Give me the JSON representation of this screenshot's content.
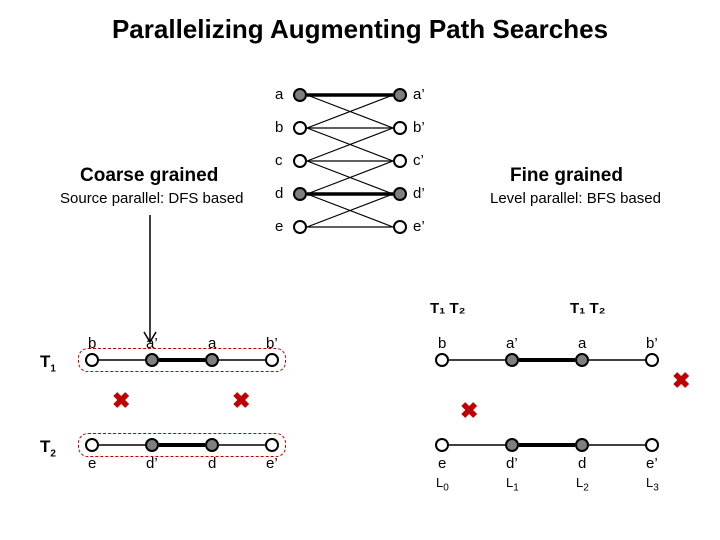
{
  "title": "Parallelizing Augmenting Path Searches",
  "left": {
    "heading": "Coarse grained",
    "sub": "Source parallel: DFS based"
  },
  "right": {
    "heading": "Fine grained",
    "sub": "Level parallel: BFS based"
  },
  "bipartite": {
    "left": [
      "a",
      "b",
      "c",
      "d",
      "e"
    ],
    "right": [
      "a’",
      "b’",
      "c’",
      "d’",
      "e’"
    ]
  },
  "threads": {
    "t1": "T",
    "t1s": "1",
    "t2": "T",
    "t2s": "2"
  },
  "pair_header_left": "T₁ T₂",
  "pair_header_right": "T₁ T₂",
  "chain1": {
    "n": [
      "b",
      "a’",
      "a",
      "b’"
    ]
  },
  "chain2": {
    "n": [
      "e",
      "d’",
      "d",
      "e’"
    ]
  },
  "levels": [
    "L",
    "0",
    "L",
    "1",
    "L",
    "2",
    "L",
    "3"
  ]
}
